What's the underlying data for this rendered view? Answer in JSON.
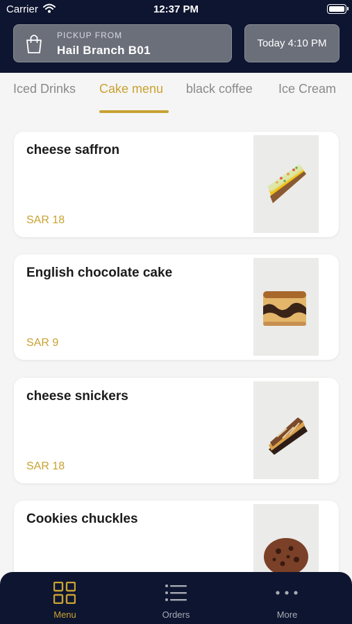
{
  "status_bar": {
    "carrier": "Carrier",
    "time": "12:37 PM"
  },
  "header": {
    "pickup_label": "PICKUP FROM",
    "branch_name": "Hail Branch B01",
    "pickup_time": "Today 4:10 PM"
  },
  "tabs": [
    {
      "label": "Iced Drinks",
      "active": false
    },
    {
      "label": "Cake menu",
      "active": true
    },
    {
      "label": "black coffee",
      "active": false
    },
    {
      "label": "Ice Cream",
      "active": false
    }
  ],
  "products": [
    {
      "name": "cheese saffron",
      "price": "SAR 18",
      "image_icon": "cheesecake-slice-icon"
    },
    {
      "name": "English chocolate cake",
      "price": "SAR 9",
      "image_icon": "chocolate-cake-slice-icon"
    },
    {
      "name": "cheese snickers",
      "price": "SAR 18",
      "image_icon": "snickers-cake-slice-icon"
    },
    {
      "name": "Cookies chuckles",
      "price": "",
      "image_icon": "cookie-icon"
    }
  ],
  "bottom_nav": [
    {
      "label": "Menu",
      "icon": "grid-icon",
      "active": true
    },
    {
      "label": "Orders",
      "icon": "list-icon",
      "active": false
    },
    {
      "label": "More",
      "icon": "more-dots-icon",
      "active": false
    }
  ],
  "colors": {
    "navy": "#0e1530",
    "gold": "#c8a232",
    "background": "#f5f5f5"
  }
}
